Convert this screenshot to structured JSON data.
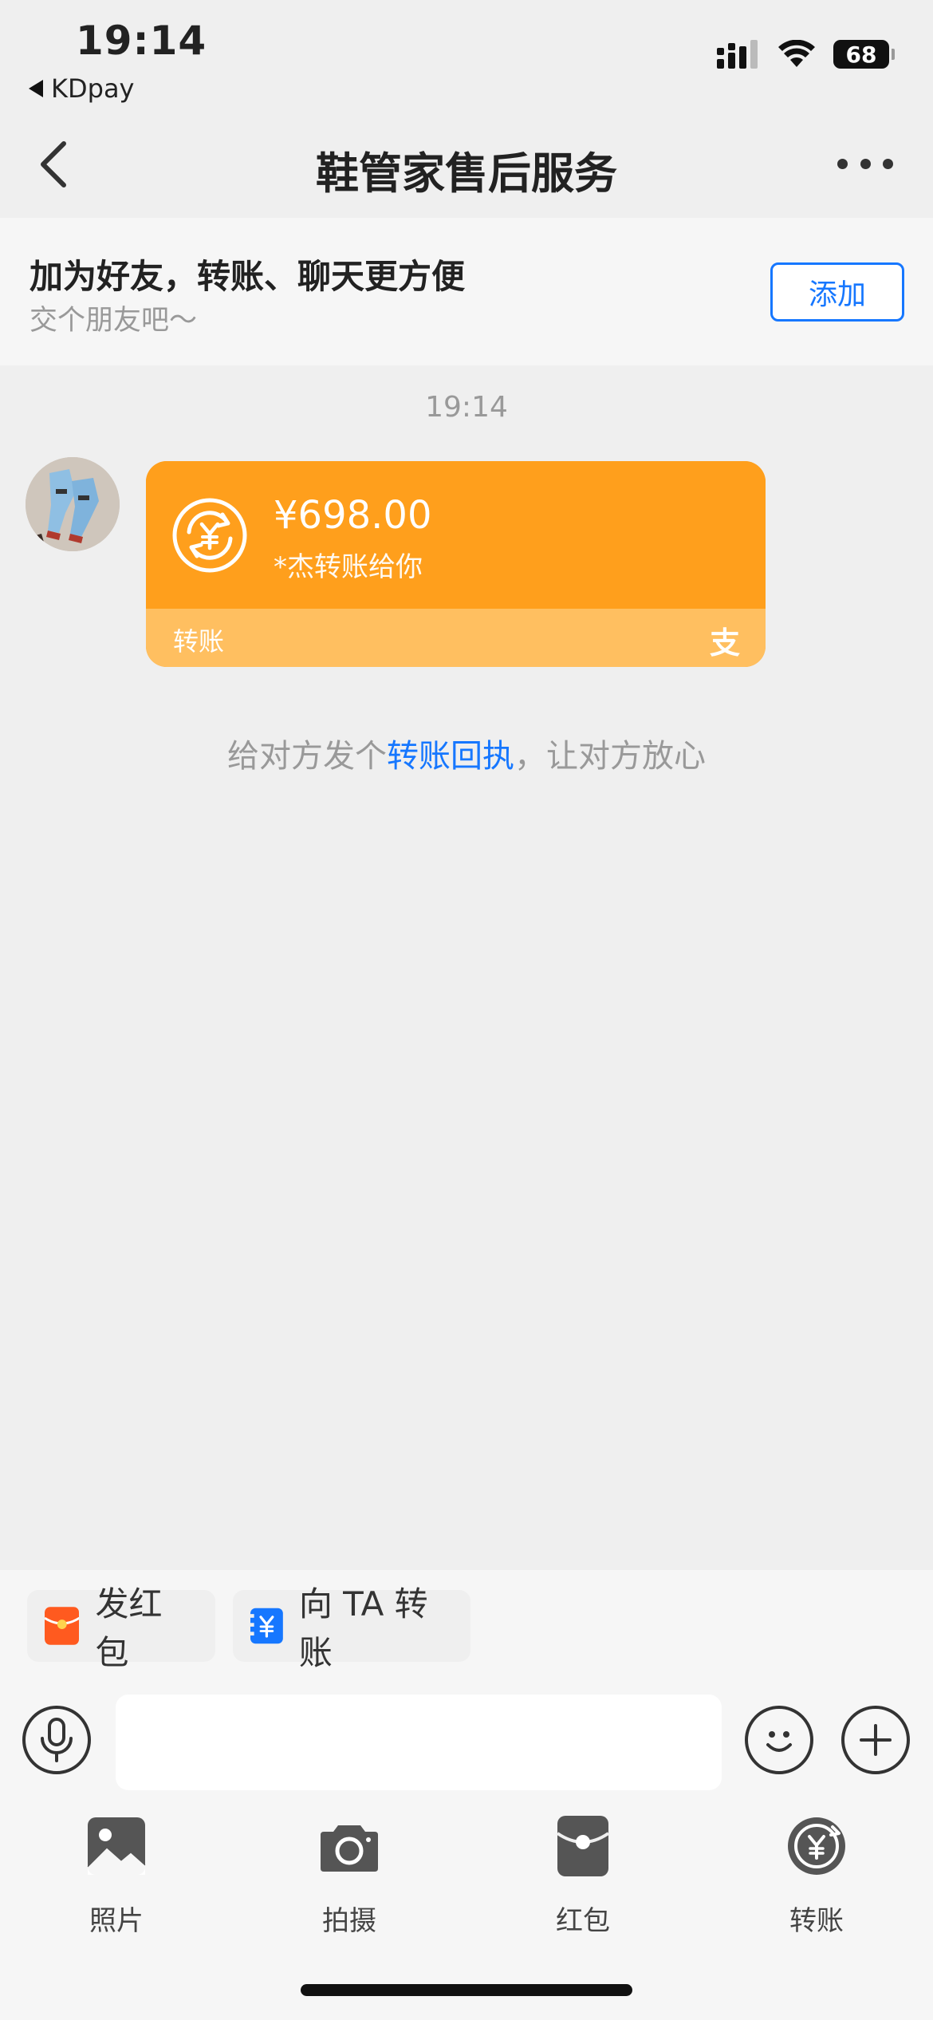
{
  "status": {
    "time": "19:14",
    "back_app": "KDpay",
    "battery": "68"
  },
  "nav": {
    "title": "鞋管家售后服务"
  },
  "banner": {
    "title": "加为好友，转账、聊天更方便",
    "subtitle": "交个朋友吧～",
    "add_label": "添加"
  },
  "chat": {
    "timestamp": "19:14",
    "transfer": {
      "amount": "¥698.00",
      "description": "*杰转账给你",
      "label": "转账",
      "brand_mark": "支"
    },
    "hint_prefix": "给对方发个",
    "hint_link": "转账回执",
    "hint_suffix": "，让对方放心"
  },
  "quick_actions": {
    "red_packet": "发红包",
    "transfer_to": "向 TA 转账"
  },
  "input": {
    "placeholder": ""
  },
  "tools": [
    {
      "label": "照片",
      "icon": "photo-icon"
    },
    {
      "label": "拍摄",
      "icon": "camera-icon"
    },
    {
      "label": "红包",
      "icon": "red-packet-icon"
    },
    {
      "label": "转账",
      "icon": "transfer-icon"
    }
  ],
  "colors": {
    "accent_blue": "#1677ff",
    "transfer_orange": "#ff9f1c",
    "transfer_orange_light": "#ffbf60",
    "red_packet": "#ff5a1f"
  }
}
